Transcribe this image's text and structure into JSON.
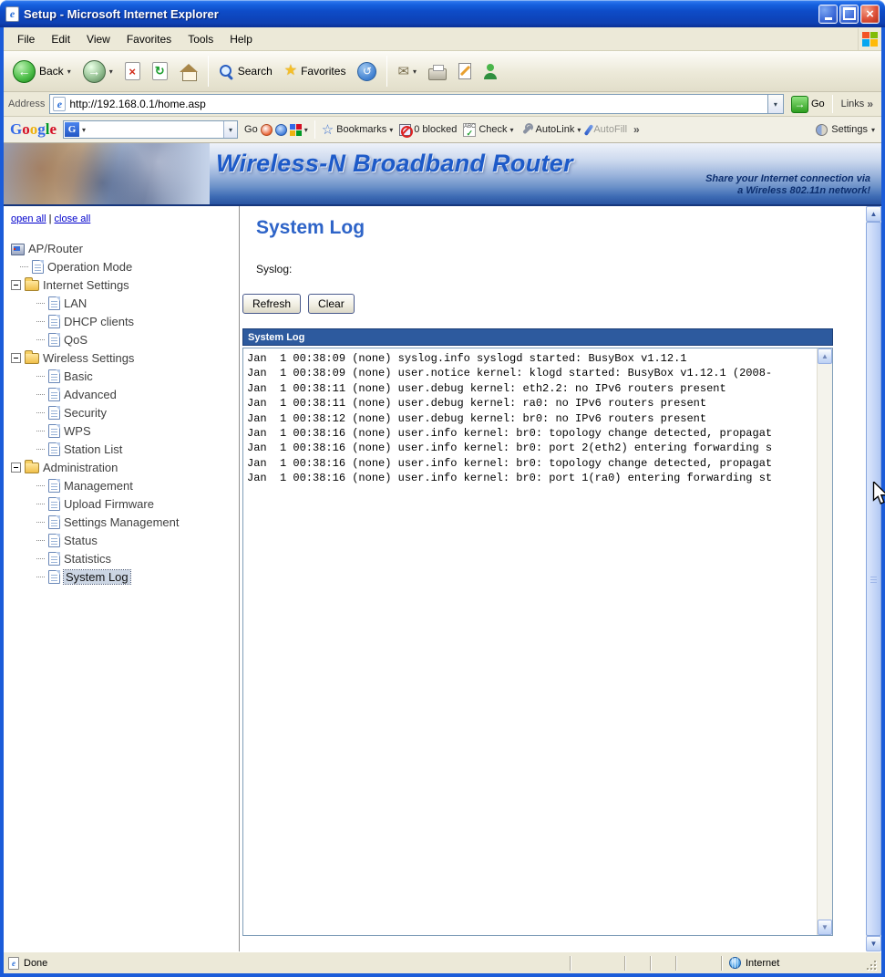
{
  "window": {
    "title": "Setup - Microsoft Internet Explorer"
  },
  "menu": {
    "items": [
      "File",
      "Edit",
      "View",
      "Favorites",
      "Tools",
      "Help"
    ]
  },
  "toolbar": {
    "back": "Back",
    "search": "Search",
    "favorites": "Favorites"
  },
  "address": {
    "label": "Address",
    "url": "http://192.168.0.1/home.asp",
    "go": "Go",
    "links": "Links"
  },
  "google": {
    "letters": [
      "G",
      "o",
      "o",
      "g",
      "l",
      "e"
    ],
    "combo_letter": "G",
    "go": "Go",
    "bookmarks": "Bookmarks",
    "blocked": "0 blocked",
    "check": "Check",
    "check_abc": "ABC",
    "autolink": "AutoLink",
    "autofill": "AutoFill",
    "settings": "Settings"
  },
  "banner": {
    "title": "Wireless-N Broadband Router",
    "tagline_line1": "Share your Internet connection via",
    "tagline_line2": "a Wireless 802.11n network!"
  },
  "sidebar": {
    "open_all": "open all",
    "close_all": "close all",
    "separator": "|",
    "tree": [
      {
        "label": "AP/Router",
        "icon": "device",
        "level": 0
      },
      {
        "label": "Operation Mode",
        "icon": "page",
        "level": 1
      },
      {
        "label": "Internet Settings",
        "icon": "folder",
        "level": 0,
        "expand": true
      },
      {
        "label": "LAN",
        "icon": "page",
        "level": 2
      },
      {
        "label": "DHCP clients",
        "icon": "page",
        "level": 2
      },
      {
        "label": "QoS",
        "icon": "page",
        "level": 2
      },
      {
        "label": "Wireless Settings",
        "icon": "folder",
        "level": 0,
        "expand": true
      },
      {
        "label": "Basic",
        "icon": "page",
        "level": 2
      },
      {
        "label": "Advanced",
        "icon": "page",
        "level": 2
      },
      {
        "label": "Security",
        "icon": "page",
        "level": 2
      },
      {
        "label": "WPS",
        "icon": "page",
        "level": 2
      },
      {
        "label": "Station List",
        "icon": "page",
        "level": 2
      },
      {
        "label": "Administration",
        "icon": "folder",
        "level": 0,
        "expand": true
      },
      {
        "label": "Management",
        "icon": "page",
        "level": 2
      },
      {
        "label": "Upload Firmware",
        "icon": "page",
        "level": 2
      },
      {
        "label": "Settings Management",
        "icon": "page",
        "level": 2
      },
      {
        "label": "Status",
        "icon": "page",
        "level": 2
      },
      {
        "label": "Statistics",
        "icon": "page",
        "level": 2
      },
      {
        "label": "System Log",
        "icon": "page",
        "level": 2,
        "selected": true
      }
    ]
  },
  "main": {
    "title": "System Log",
    "syslog_label": "Syslog:",
    "refresh_button": "Refresh",
    "clear_button": "Clear",
    "log_header": "System Log",
    "log_lines": [
      "Jan  1 00:38:09 (none) syslog.info syslogd started: BusyBox v1.12.1",
      "Jan  1 00:38:09 (none) user.notice kernel: klogd started: BusyBox v1.12.1 (2008-",
      "Jan  1 00:38:11 (none) user.debug kernel: eth2.2: no IPv6 routers present",
      "Jan  1 00:38:11 (none) user.debug kernel: ra0: no IPv6 routers present",
      "Jan  1 00:38:12 (none) user.debug kernel: br0: no IPv6 routers present",
      "Jan  1 00:38:16 (none) user.info kernel: br0: topology change detected, propagat",
      "Jan  1 00:38:16 (none) user.info kernel: br0: port 2(eth2) entering forwarding s",
      "Jan  1 00:38:16 (none) user.info kernel: br0: topology change detected, propagat",
      "Jan  1 00:38:16 (none) user.info kernel: br0: port 1(ra0) entering forwarding st"
    ]
  },
  "status": {
    "done": "Done",
    "zone": "Internet"
  },
  "icons": {
    "back": "←",
    "forward": "→",
    "stop": "×",
    "refresh": "↻",
    "history": "↺",
    "mail": "✉",
    "caret": "▾",
    "chevron": "»",
    "go_arrow": "→",
    "up": "▲",
    "down": "▼",
    "check": "✓"
  },
  "colors": {
    "titlebar_blue": "#1b5cd9",
    "xp_face": "#ece9d8",
    "banner_title_blue": "#1d5ac8",
    "panel_header_navy": "#2d5a9e",
    "selection_bg": "#ccd6e4",
    "link_blue": "#0000cc",
    "heading_blue": "#2e64c8"
  }
}
